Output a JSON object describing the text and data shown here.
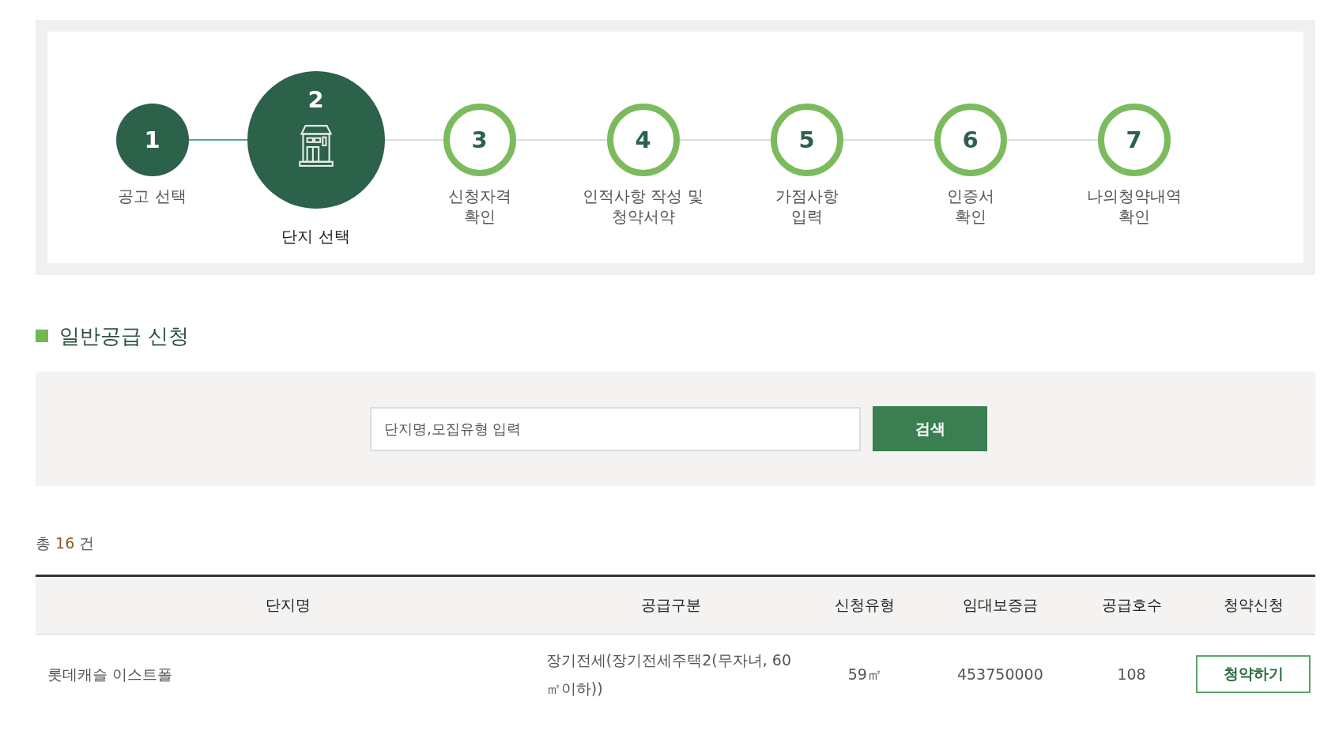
{
  "steps": [
    {
      "number": "1",
      "label": "공고 선택",
      "completed": true,
      "selected": false
    },
    {
      "number": "2",
      "label": "단지 선택",
      "completed": false,
      "selected": true
    },
    {
      "number": "3",
      "label": "신청자격\n확인",
      "completed": false,
      "selected": false
    },
    {
      "number": "4",
      "label": "인적사항 작성 및\n청약서약",
      "completed": false,
      "selected": false
    },
    {
      "number": "5",
      "label": "가점사항\n입력",
      "completed": false,
      "selected": false
    },
    {
      "number": "6",
      "label": "인증서\n확인",
      "completed": false,
      "selected": false
    },
    {
      "number": "7",
      "label": "나의청약내역\n확인",
      "completed": false,
      "selected": false
    }
  ],
  "section_title": "일반공급 신청",
  "search": {
    "placeholder": "단지명,모집유형 입력",
    "button": "검색"
  },
  "total": {
    "prefix": "총",
    "count": "16",
    "suffix": "건"
  },
  "table": {
    "columns": [
      "단지명",
      "공급구분",
      "신청유형",
      "임대보증금",
      "공급호수",
      "청약신청"
    ],
    "rows": [
      {
        "cells": [
          "롯데캐슬 이스트폴",
          "장기전세(장기전세주택2(무자녀, 60㎡이하))",
          "59㎡",
          "453750000",
          "108"
        ],
        "action": "청약하기"
      }
    ]
  }
}
